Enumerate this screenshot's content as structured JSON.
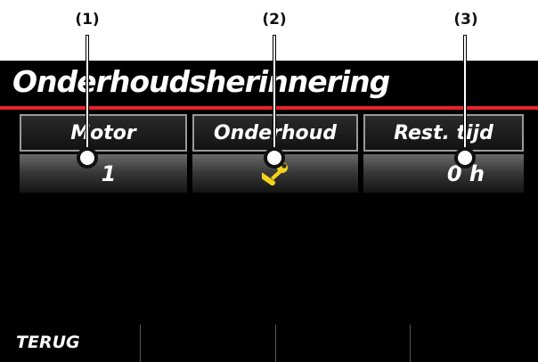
{
  "callouts": [
    "(1)",
    "(2)",
    "(3)"
  ],
  "screen": {
    "title": "Onderhoudsherinnering",
    "table": {
      "headers": [
        "Motor",
        "Onderhoud",
        "Rest. tijd"
      ],
      "row": {
        "motor": "1",
        "onderhoud_icon": "wrench-icon",
        "rest_tijd": "0 h"
      }
    },
    "footer": {
      "back_label": "TERUG"
    }
  },
  "colors": {
    "accent_red": "#e8222b",
    "wrench_yellow": "#f2d21b",
    "background": "#000000"
  }
}
